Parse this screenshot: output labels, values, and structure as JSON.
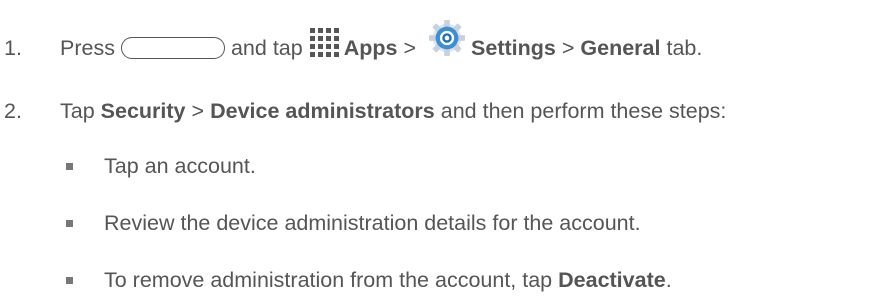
{
  "steps": [
    {
      "number": "1.",
      "parts": {
        "press": "Press",
        "and_tap": "and tap",
        "apps": "Apps",
        "sep1": ">",
        "settings": "Settings",
        "sep2": ">",
        "general": "General",
        "tab": "tab."
      }
    },
    {
      "number": "2.",
      "parts": {
        "tap": "Tap",
        "security": "Security",
        "sep": ">",
        "device_admins": "Device administrators",
        "rest": "and then perform these steps:"
      }
    }
  ],
  "substeps": [
    {
      "text": "Tap an account."
    },
    {
      "text": "Review the device administration details for the account."
    },
    {
      "prefix": "To remove administration from the account, tap",
      "bold": "Deactivate",
      "suffix": "."
    }
  ],
  "icons": {
    "home": "home-button-icon",
    "apps": "apps-grid-icon",
    "settings": "settings-gear-icon"
  },
  "colors": {
    "text": "#555555",
    "gear_blue": "#3a8fd6"
  }
}
